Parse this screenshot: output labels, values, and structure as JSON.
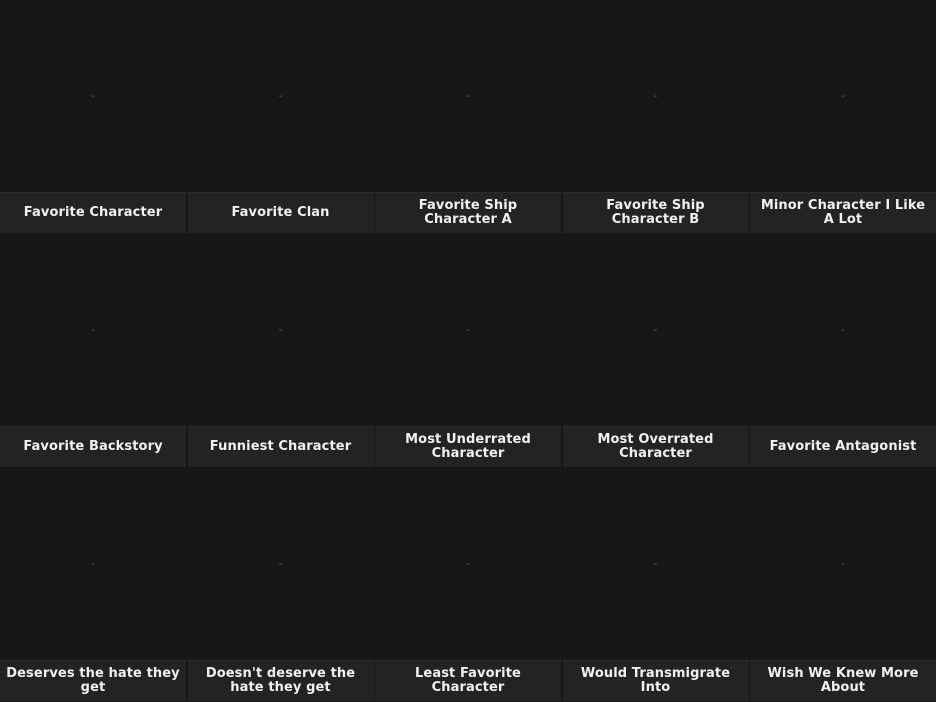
{
  "placeholder_text": "-",
  "cells": [
    {
      "label": "Favorite Character"
    },
    {
      "label": "Favorite Clan"
    },
    {
      "label": "Favorite Ship Character A"
    },
    {
      "label": "Favorite Ship Character B"
    },
    {
      "label": "Minor Character I Like A Lot"
    },
    {
      "label": "Favorite Backstory"
    },
    {
      "label": "Funniest Character"
    },
    {
      "label": "Most Underrated Character"
    },
    {
      "label": "Most Overrated Character"
    },
    {
      "label": "Favorite Antagonist"
    },
    {
      "label": "Deserves the hate they get"
    },
    {
      "label": "Doesn't deserve the hate they get"
    },
    {
      "label": "Least Favorite Character"
    },
    {
      "label": "Would Transmigrate Into"
    },
    {
      "label": "Wish We Knew More About"
    }
  ]
}
